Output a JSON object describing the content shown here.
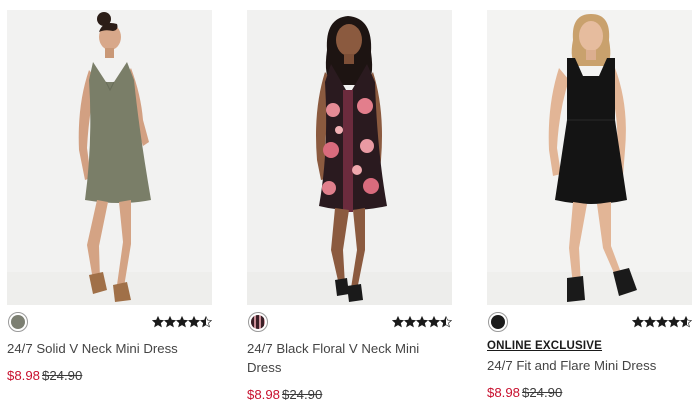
{
  "products": [
    {
      "name": "24/7 Solid V Neck Mini Dress",
      "sale_price": "$8.98",
      "original_price": "$24.90",
      "rating": 4.5,
      "badge": "",
      "swatch_color": "#7c7f72",
      "dress_color": "#7a7e68"
    },
    {
      "name": "24/7 Black Floral V Neck Mini Dress",
      "sale_price": "$8.98",
      "original_price": "$24.90",
      "rating": 4.5,
      "badge": "",
      "swatch_color": "#3a1f26",
      "dress_color": "#2a1a1f"
    },
    {
      "name": "24/7 Fit and Flare Mini Dress",
      "sale_price": "$8.98",
      "original_price": "$24.90",
      "rating": 4.6,
      "badge": "ONLINE EXCLUSIVE",
      "swatch_color": "#1a1a1a",
      "dress_color": "#141414"
    }
  ],
  "colors": {
    "sale_red": "#c8102e",
    "star": "#1a1a1a",
    "photo_bg": "#f1f1f1"
  }
}
